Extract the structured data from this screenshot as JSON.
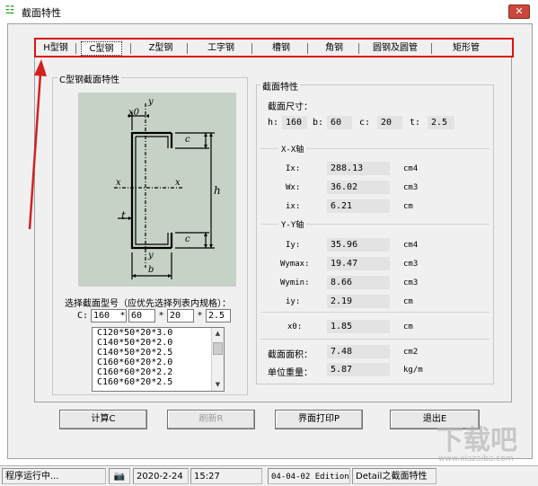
{
  "window": {
    "title": "截面特性"
  },
  "tabs": [
    {
      "label": "H型钢",
      "active": false
    },
    {
      "label": "C型钢",
      "active": true
    },
    {
      "label": "Z型钢",
      "active": false
    },
    {
      "label": "工字钢",
      "active": false
    },
    {
      "label": "槽钢",
      "active": false
    },
    {
      "label": "角钢",
      "active": false
    },
    {
      "label": "圆钢及圆管",
      "active": false
    },
    {
      "label": "矩形管",
      "active": false
    }
  ],
  "left_group": {
    "title": "C型钢截面特性",
    "diagram_labels": {
      "x0": "x0",
      "y_top": "y",
      "y_bottom": "y",
      "x_left": "x",
      "x_right": "x",
      "c_top": "c",
      "c_bottom": "c",
      "h": "h",
      "t": "t",
      "b": "b"
    },
    "select_label": "选择截面型号（应优先选择列表内规格）：",
    "c_label": "C:",
    "inputs": [
      "160",
      "60",
      "20",
      "2.5"
    ],
    "list_items": [
      "C120*50*20*3.0",
      "C140*50*20*2.0",
      "C140*50*20*2.5",
      "C160*60*20*2.0",
      "C160*60*20*2.2",
      "C160*60*20*2.5"
    ]
  },
  "right_group": {
    "title": "截面特性",
    "dims_title": "截面尺寸：",
    "dims": [
      {
        "label": "h:",
        "value": "160"
      },
      {
        "label": "b:",
        "value": "60"
      },
      {
        "label": "c:",
        "value": "20"
      },
      {
        "label": "t:",
        "value": "2.5"
      }
    ],
    "xx_title": "X-X轴",
    "xx": [
      {
        "label": "Ix:",
        "value": "288.13",
        "unit": "cm4"
      },
      {
        "label": "Wx:",
        "value": "36.02",
        "unit": "cm3"
      },
      {
        "label": "ix:",
        "value": "6.21",
        "unit": "cm"
      }
    ],
    "yy_title": "Y-Y轴",
    "yy": [
      {
        "label": "Iy:",
        "value": "35.96",
        "unit": "cm4"
      },
      {
        "label": "Wymax:",
        "value": "19.47",
        "unit": "cm3"
      },
      {
        "label": "Wymin:",
        "value": "8.66",
        "unit": "cm3"
      },
      {
        "label": "iy:",
        "value": "2.19",
        "unit": "cm"
      }
    ],
    "x0": {
      "label": "x0:",
      "value": "1.85",
      "unit": "cm"
    },
    "area": {
      "label": "截面面积：",
      "value": "7.48",
      "unit": "cm2"
    },
    "weight": {
      "label": "单位重量：",
      "value": "5.87",
      "unit": "kg/m"
    }
  },
  "buttons": {
    "calc": "计算C",
    "refresh": "刷新R",
    "print": "界面打印P",
    "exit": "退出E"
  },
  "statusbar": {
    "status": "程序运行中...",
    "date": "2020-2-24",
    "time": "15:27",
    "edition": "04-04-02 Edition",
    "detail": "Detail之截面特性"
  },
  "watermark": {
    "text": "下载吧",
    "url": "www.xiazaiba.com"
  },
  "colors": {
    "highlight": "#e01010",
    "diagram_bg": "#c7d2c6"
  }
}
